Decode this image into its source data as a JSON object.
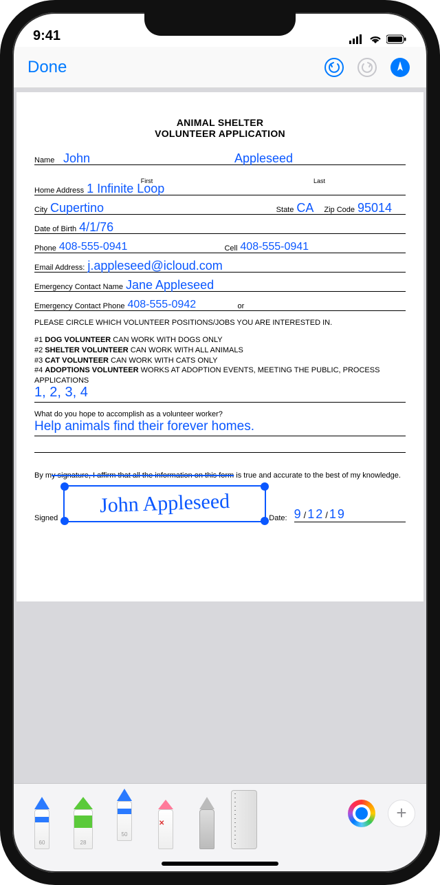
{
  "status": {
    "time": "9:41"
  },
  "nav": {
    "done_label": "Done"
  },
  "doc": {
    "title_line1": "ANIMAL SHELTER",
    "title_line2": "VOLUNTEER APPLICATION",
    "labels": {
      "name": "Name",
      "first": "First",
      "last": "Last",
      "home_address": "Home Address",
      "city": "City",
      "state": "State",
      "zip": "Zip Code",
      "dob": "Date of Birth",
      "phone": "Phone",
      "cell": "Cell",
      "email": "Email Address:",
      "econtact_name": "Emergency Contact Name",
      "econtact_phone": "Emergency Contact Phone",
      "or": "or",
      "signed": "Signed",
      "date": "Date:"
    },
    "values": {
      "first_name": "John",
      "last_name": "Appleseed",
      "address": "1 Infinite Loop",
      "city": "Cupertino",
      "state": "CA",
      "zip": "95014",
      "dob": "4/1/76",
      "phone": "408-555-0941",
      "cell": "408-555-0941",
      "email": "j.appleseed@icloud.com",
      "econtact_name": "Jane Appleseed",
      "econtact_phone": "408-555-0942",
      "positions_chosen": "1, 2, 3, 4",
      "accomplish": "Help animals find their forever homes.",
      "signature": "John Appleseed",
      "sign_date_m": "9",
      "sign_date_d": "12",
      "sign_date_y": "19"
    },
    "positions_intro": "PLEASE CIRCLE WHICH VOLUNTEER POSITIONS/JOBS YOU ARE INTERESTED IN.",
    "positions": {
      "p1a": "#1 ",
      "p1b": "DOG VOLUNTEER",
      "p1c": " CAN WORK WITH DOGS ONLY",
      "p2a": "#2 ",
      "p2b": "SHELTER VOLUNTEER",
      "p2c": " CAN WORK WITH ALL ANIMALS",
      "p3a": "#3 ",
      "p3b": "CAT VOLUNTEER",
      "p3c": " CAN WORK WITH CATS ONLY",
      "p4a": "#4 ",
      "p4b": "ADOPTIONS VOLUNTEER",
      "p4c": " WORKS AT ADOPTION EVENTS, MEETING THE PUBLIC, PROCESS APPLICATIONS"
    },
    "accomplish_q": "What do you hope to accomplish as a volunteer worker?",
    "affirm_pre": "By m",
    "affirm_strike": "y signature, I affirm that all the information on this form",
    "affirm_post": " is true and accurate to the best of my knowledge."
  },
  "tools": {
    "pen_size": "60",
    "marker_size": "28",
    "pencil_size": "50"
  }
}
